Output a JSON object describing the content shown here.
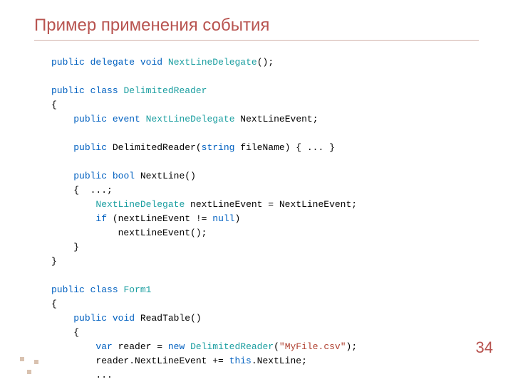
{
  "title": "Пример применения события",
  "pagenum": "34",
  "t": {
    "public": "public",
    "delegate": "delegate",
    "void": "void",
    "class": "class",
    "event": "event",
    "string": "string",
    "bool": "bool",
    "if": "if",
    "null": "null",
    "var": "var",
    "new": "new",
    "this": "this",
    "NextLineDelegate": "NextLineDelegate",
    "DelimitedReader": "DelimitedReader",
    "Form1": "Form1",
    "fileName": " fileName) { ... }",
    "NextLineEventDecl": " NextLineEvent;",
    "NextLineSig": " NextLine()",
    "blockOpen": "{  ...;",
    "localDecl": " nextLineEvent = NextLineEvent;",
    "ifCond": " (nextLineEvent != ",
    "ifClose": ")",
    "call": "nextLineEvent();",
    "brace": "}",
    "openBrace": "{",
    "ReadTableSig": " ReadTable()",
    "readerEq": " reader = ",
    "ctorOpen": "(",
    "fileStr": "\"MyFile.csv\"",
    "ctorClose": ");",
    "subscribe1": "reader.NextLineEvent += ",
    "subscribe2": ".NextLine;",
    "dots": "...",
    "parens": "();",
    "space": " ",
    "ctorSig": " DelimitedReader("
  }
}
